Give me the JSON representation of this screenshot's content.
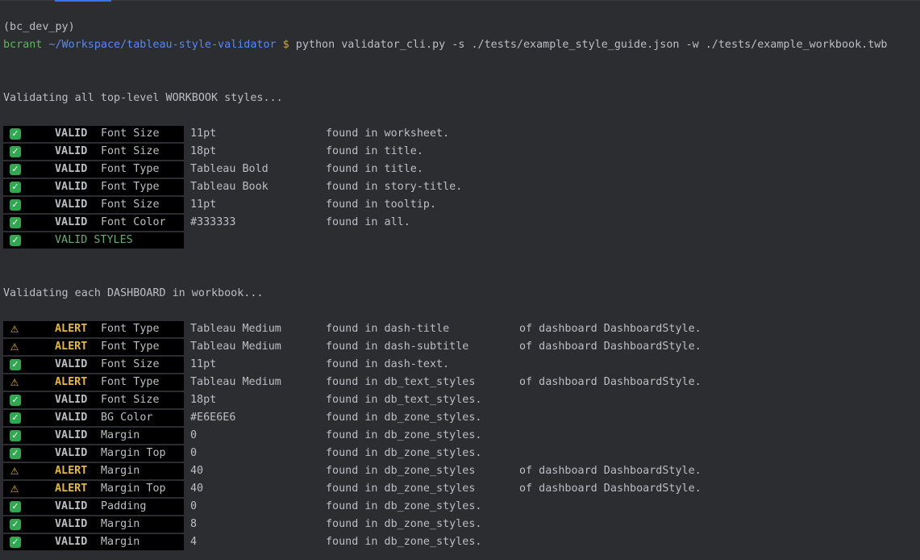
{
  "terminal": {
    "env_line": "(bc_dev_py)",
    "prompt_user": "bcrant",
    "prompt_path": "~/Workspace/tableau-style-validator",
    "prompt_symbol": "$",
    "command": "python validator_cli.py -s ./tests/example_style_guide.json -w ./tests/example_workbook.twb"
  },
  "colors": {
    "background": "#2b2d30",
    "text": "#bcbec4",
    "user": "#5fb65f",
    "path": "#548af7",
    "valid_icon": "#2fa84f",
    "alert": "#e7b92b",
    "badge_bg": "#000000",
    "styles_label": "#6aab73"
  },
  "workbook": {
    "heading": "Validating all top-level WORKBOOK styles...",
    "rows": [
      {
        "icon": "check-icon",
        "status": "VALID",
        "label": "Font Size",
        "value": "11pt",
        "found": "found in worksheet.",
        "of": ""
      },
      {
        "icon": "check-icon",
        "status": "VALID",
        "label": "Font Size",
        "value": "18pt",
        "found": "found in title.",
        "of": ""
      },
      {
        "icon": "check-icon",
        "status": "VALID",
        "label": "Font Type",
        "value": "Tableau Bold",
        "found": "found in title.",
        "of": ""
      },
      {
        "icon": "check-icon",
        "status": "VALID",
        "label": "Font Type",
        "value": "Tableau Book",
        "found": "found in story-title.",
        "of": ""
      },
      {
        "icon": "check-icon",
        "status": "VALID",
        "label": "Font Size",
        "value": "11pt",
        "found": "found in tooltip.",
        "of": ""
      },
      {
        "icon": "check-icon",
        "status": "VALID",
        "label": "Font Color",
        "value": "#333333",
        "found": "found in all.",
        "of": ""
      }
    ],
    "summary": {
      "icon": "check-icon",
      "label": "VALID STYLES"
    }
  },
  "dashboard": {
    "heading": "Validating each DASHBOARD in workbook...",
    "rows": [
      {
        "icon": "warning-icon",
        "status": "ALERT",
        "label": "Font Type",
        "value": "Tableau Medium",
        "found": "found in dash-title",
        "of": "of dashboard DashboardStyle."
      },
      {
        "icon": "warning-icon",
        "status": "ALERT",
        "label": "Font Type",
        "value": "Tableau Medium",
        "found": "found in dash-subtitle",
        "of": "of dashboard DashboardStyle."
      },
      {
        "icon": "check-icon",
        "status": "VALID",
        "label": "Font Size",
        "value": "11pt",
        "found": "found in dash-text.",
        "of": ""
      },
      {
        "icon": "warning-icon",
        "status": "ALERT",
        "label": "Font Type",
        "value": "Tableau Medium",
        "found": "found in db_text_styles",
        "of": "of dashboard DashboardStyle."
      },
      {
        "icon": "check-icon",
        "status": "VALID",
        "label": "Font Size",
        "value": "18pt",
        "found": "found in db_text_styles.",
        "of": ""
      },
      {
        "icon": "check-icon",
        "status": "VALID",
        "label": "BG Color",
        "value": "#E6E6E6",
        "found": "found in db_zone_styles.",
        "of": ""
      },
      {
        "icon": "check-icon",
        "status": "VALID",
        "label": "Margin",
        "value": "0",
        "found": "found in db_zone_styles.",
        "of": ""
      },
      {
        "icon": "check-icon",
        "status": "VALID",
        "label": "Margin Top",
        "value": "0",
        "found": "found in db_zone_styles.",
        "of": ""
      },
      {
        "icon": "warning-icon",
        "status": "ALERT",
        "label": "Margin",
        "value": "40",
        "found": "found in db_zone_styles",
        "of": "of dashboard DashboardStyle."
      },
      {
        "icon": "warning-icon",
        "status": "ALERT",
        "label": "Margin Top",
        "value": "40",
        "found": "found in db_zone_styles",
        "of": "of dashboard DashboardStyle."
      },
      {
        "icon": "check-icon",
        "status": "VALID",
        "label": "Padding",
        "value": "0",
        "found": "found in db_zone_styles.",
        "of": ""
      },
      {
        "icon": "check-icon",
        "status": "VALID",
        "label": "Margin",
        "value": "8",
        "found": "found in db_zone_styles.",
        "of": ""
      },
      {
        "icon": "check-icon",
        "status": "VALID",
        "label": "Margin",
        "value": "4",
        "found": "found in db_zone_styles.",
        "of": ""
      }
    ]
  }
}
